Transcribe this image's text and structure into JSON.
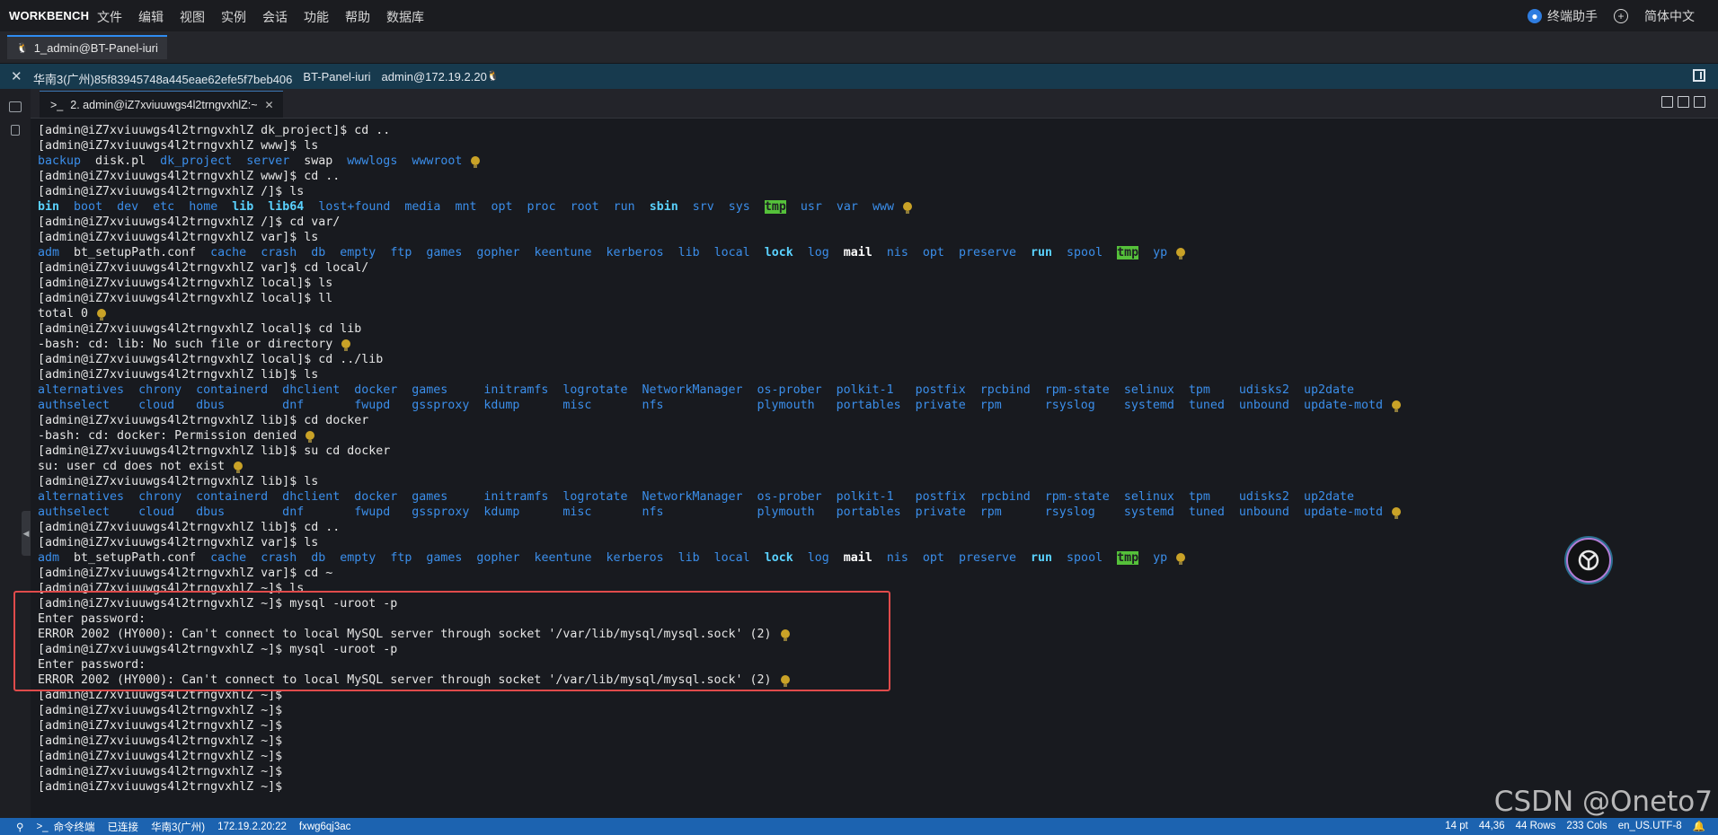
{
  "menubar": {
    "brand": "WORKBENCH",
    "items": [
      "文件",
      "编辑",
      "视图",
      "实例",
      "会话",
      "功能",
      "帮助",
      "数据库"
    ],
    "assistant": "终端助手",
    "language": "简体中文"
  },
  "session_tab": {
    "label": "1_admin@BT-Panel-iuri"
  },
  "infobar": {
    "region": "华南3(广州)85f83945748a445eae62efe5f7beb406",
    "host": "BT-Panel-iuri",
    "user": "admin@172.19.2.20"
  },
  "terminal_tab": {
    "label": "2. admin@iZ7xviuuwgs4l2trngvxhlZ:~",
    "prompt_glyph": ">_"
  },
  "statusbar": {
    "left": [
      "命令终端",
      "已连接",
      "华南3(广州)",
      "172.19.2.20:22",
      "fxwg6qj3ac"
    ],
    "font_size": "14 pt",
    "cursor": "44,36",
    "rows": "44 Rows",
    "cols": "233 Cols",
    "encoding": "en_US.UTF-8"
  },
  "watermark": "CSDN @Oneto7",
  "terminal_lines": [
    [
      [
        "t",
        "[admin@iZ7xviuuwgs4l2trngvxhlZ dk_project]$ cd .."
      ]
    ],
    [
      [
        "t",
        "[admin@iZ7xviuuwgs4l2trngvxhlZ www]$ ls"
      ]
    ],
    [
      [
        "d",
        "backup"
      ],
      [
        "t",
        "  disk.pl  "
      ],
      [
        "d",
        "dk_project"
      ],
      [
        "t",
        "  "
      ],
      [
        "d",
        "server"
      ],
      [
        "t",
        "  swap  "
      ],
      [
        "d",
        "wwwlogs"
      ],
      [
        "t",
        "  "
      ],
      [
        "d",
        "wwwroot"
      ],
      [
        "bulb",
        ""
      ]
    ],
    [
      [
        "t",
        "[admin@iZ7xviuuwgs4l2trngvxhlZ www]$ cd .."
      ]
    ],
    [
      [
        "t",
        "[admin@iZ7xviuuwgs4l2trngvxhlZ /]$ ls"
      ]
    ],
    [
      [
        "bb",
        "bin"
      ],
      [
        "t",
        "  "
      ],
      [
        "d",
        "boot"
      ],
      [
        "t",
        "  "
      ],
      [
        "d",
        "dev"
      ],
      [
        "t",
        "  "
      ],
      [
        "d",
        "etc"
      ],
      [
        "t",
        "  "
      ],
      [
        "d",
        "home"
      ],
      [
        "t",
        "  "
      ],
      [
        "bb",
        "lib"
      ],
      [
        "t",
        "  "
      ],
      [
        "bb",
        "lib64"
      ],
      [
        "t",
        "  "
      ],
      [
        "d",
        "lost+found"
      ],
      [
        "t",
        "  "
      ],
      [
        "d",
        "media"
      ],
      [
        "t",
        "  "
      ],
      [
        "d",
        "mnt"
      ],
      [
        "t",
        "  "
      ],
      [
        "d",
        "opt"
      ],
      [
        "t",
        "  "
      ],
      [
        "d",
        "proc"
      ],
      [
        "t",
        "  "
      ],
      [
        "d",
        "root"
      ],
      [
        "t",
        "  "
      ],
      [
        "d",
        "run"
      ],
      [
        "t",
        "  "
      ],
      [
        "bb",
        "sbin"
      ],
      [
        "t",
        "  "
      ],
      [
        "d",
        "srv"
      ],
      [
        "t",
        "  "
      ],
      [
        "d",
        "sys"
      ],
      [
        "t",
        "  "
      ],
      [
        "tmp",
        "tmp"
      ],
      [
        "t",
        "  "
      ],
      [
        "d",
        "usr"
      ],
      [
        "t",
        "  "
      ],
      [
        "d",
        "var"
      ],
      [
        "t",
        "  "
      ],
      [
        "d",
        "www"
      ],
      [
        "bulb",
        ""
      ]
    ],
    [
      [
        "t",
        "[admin@iZ7xviuuwgs4l2trngvxhlZ /]$ cd var/"
      ]
    ],
    [
      [
        "t",
        "[admin@iZ7xviuuwgs4l2trngvxhlZ var]$ ls"
      ]
    ],
    [
      [
        "d",
        "adm"
      ],
      [
        "t",
        "  bt_setupPath.conf  "
      ],
      [
        "d",
        "cache"
      ],
      [
        "t",
        "  "
      ],
      [
        "d",
        "crash"
      ],
      [
        "t",
        "  "
      ],
      [
        "d",
        "db"
      ],
      [
        "t",
        "  "
      ],
      [
        "d",
        "empty"
      ],
      [
        "t",
        "  "
      ],
      [
        "d",
        "ftp"
      ],
      [
        "t",
        "  "
      ],
      [
        "d",
        "games"
      ],
      [
        "t",
        "  "
      ],
      [
        "d",
        "gopher"
      ],
      [
        "t",
        "  "
      ],
      [
        "d",
        "keentune"
      ],
      [
        "t",
        "  "
      ],
      [
        "d",
        "kerberos"
      ],
      [
        "t",
        "  "
      ],
      [
        "d",
        "lib"
      ],
      [
        "t",
        "  "
      ],
      [
        "d",
        "local"
      ],
      [
        "t",
        "  "
      ],
      [
        "bb",
        "lock"
      ],
      [
        "t",
        "  "
      ],
      [
        "d",
        "log"
      ],
      [
        "t",
        "  "
      ],
      [
        "bold",
        "mail"
      ],
      [
        "t",
        "  "
      ],
      [
        "d",
        "nis"
      ],
      [
        "t",
        "  "
      ],
      [
        "d",
        "opt"
      ],
      [
        "t",
        "  "
      ],
      [
        "d",
        "preserve"
      ],
      [
        "t",
        "  "
      ],
      [
        "bb",
        "run"
      ],
      [
        "t",
        "  "
      ],
      [
        "d",
        "spool"
      ],
      [
        "t",
        "  "
      ],
      [
        "tmp",
        "tmp"
      ],
      [
        "t",
        "  "
      ],
      [
        "d",
        "yp"
      ],
      [
        "bulb",
        ""
      ]
    ],
    [
      [
        "t",
        "[admin@iZ7xviuuwgs4l2trngvxhlZ var]$ cd local/"
      ]
    ],
    [
      [
        "t",
        "[admin@iZ7xviuuwgs4l2trngvxhlZ local]$ ls"
      ]
    ],
    [
      [
        "t",
        "[admin@iZ7xviuuwgs4l2trngvxhlZ local]$ ll"
      ]
    ],
    [
      [
        "t",
        "total 0"
      ],
      [
        "bulb",
        ""
      ]
    ],
    [
      [
        "t",
        "[admin@iZ7xviuuwgs4l2trngvxhlZ local]$ cd lib"
      ]
    ],
    [
      [
        "t",
        "-bash: cd: lib: No such file or directory"
      ],
      [
        "bulb",
        ""
      ]
    ],
    [
      [
        "t",
        "[admin@iZ7xviuuwgs4l2trngvxhlZ local]$ cd ../lib"
      ]
    ],
    [
      [
        "t",
        "[admin@iZ7xviuuwgs4l2trngvxhlZ lib]$ ls"
      ]
    ],
    [
      [
        "d",
        "alternatives  chrony  containerd  dhclient  docker  games     initramfs  logrotate  NetworkManager  os-prober  polkit-1   postfix  rpcbind  rpm-state  selinux  tpm    udisks2  up2date"
      ]
    ],
    [
      [
        "d",
        "authselect    cloud   dbus        dnf       fwupd   gssproxy  kdump      misc       nfs             plymouth   portables  private  rpm      rsyslog    systemd  tuned  unbound  update-motd"
      ],
      [
        "bulb",
        ""
      ]
    ],
    [
      [
        "t",
        "[admin@iZ7xviuuwgs4l2trngvxhlZ lib]$ cd docker"
      ]
    ],
    [
      [
        "t",
        "-bash: cd: docker: Permission denied"
      ],
      [
        "bulb",
        ""
      ]
    ],
    [
      [
        "t",
        "[admin@iZ7xviuuwgs4l2trngvxhlZ lib]$ su cd docker"
      ]
    ],
    [
      [
        "t",
        "su: user cd does not exist"
      ],
      [
        "bulb",
        ""
      ]
    ],
    [
      [
        "t",
        "[admin@iZ7xviuuwgs4l2trngvxhlZ lib]$ ls"
      ]
    ],
    [
      [
        "d",
        "alternatives  chrony  containerd  dhclient  docker  games     initramfs  logrotate  NetworkManager  os-prober  polkit-1   postfix  rpcbind  rpm-state  selinux  tpm    udisks2  up2date"
      ]
    ],
    [
      [
        "d",
        "authselect    cloud   dbus        dnf       fwupd   gssproxy  kdump      misc       nfs             plymouth   portables  private  rpm      rsyslog    systemd  tuned  unbound  update-motd"
      ],
      [
        "bulb",
        ""
      ]
    ],
    [
      [
        "t",
        "[admin@iZ7xviuuwgs4l2trngvxhlZ lib]$ cd .."
      ]
    ],
    [
      [
        "t",
        "[admin@iZ7xviuuwgs4l2trngvxhlZ var]$ ls"
      ]
    ],
    [
      [
        "d",
        "adm"
      ],
      [
        "t",
        "  bt_setupPath.conf  "
      ],
      [
        "d",
        "cache"
      ],
      [
        "t",
        "  "
      ],
      [
        "d",
        "crash"
      ],
      [
        "t",
        "  "
      ],
      [
        "d",
        "db"
      ],
      [
        "t",
        "  "
      ],
      [
        "d",
        "empty"
      ],
      [
        "t",
        "  "
      ],
      [
        "d",
        "ftp"
      ],
      [
        "t",
        "  "
      ],
      [
        "d",
        "games"
      ],
      [
        "t",
        "  "
      ],
      [
        "d",
        "gopher"
      ],
      [
        "t",
        "  "
      ],
      [
        "d",
        "keentune"
      ],
      [
        "t",
        "  "
      ],
      [
        "d",
        "kerberos"
      ],
      [
        "t",
        "  "
      ],
      [
        "d",
        "lib"
      ],
      [
        "t",
        "  "
      ],
      [
        "d",
        "local"
      ],
      [
        "t",
        "  "
      ],
      [
        "bb",
        "lock"
      ],
      [
        "t",
        "  "
      ],
      [
        "d",
        "log"
      ],
      [
        "t",
        "  "
      ],
      [
        "bold",
        "mail"
      ],
      [
        "t",
        "  "
      ],
      [
        "d",
        "nis"
      ],
      [
        "t",
        "  "
      ],
      [
        "d",
        "opt"
      ],
      [
        "t",
        "  "
      ],
      [
        "d",
        "preserve"
      ],
      [
        "t",
        "  "
      ],
      [
        "bb",
        "run"
      ],
      [
        "t",
        "  "
      ],
      [
        "d",
        "spool"
      ],
      [
        "t",
        "  "
      ],
      [
        "tmp",
        "tmp"
      ],
      [
        "t",
        "  "
      ],
      [
        "d",
        "yp"
      ],
      [
        "bulb",
        ""
      ]
    ],
    [
      [
        "t",
        "[admin@iZ7xviuuwgs4l2trngvxhlZ var]$ cd ~"
      ]
    ],
    [
      [
        "t",
        "[admin@iZ7xviuuwgs4l2trngvxhlZ ~]$ ls"
      ]
    ],
    [
      [
        "t",
        "[admin@iZ7xviuuwgs4l2trngvxhlZ ~]$ mysql -uroot -p"
      ]
    ],
    [
      [
        "t",
        "Enter password:"
      ]
    ],
    [
      [
        "t",
        "ERROR 2002 (HY000): Can't connect to local MySQL server through socket '/var/lib/mysql/mysql.sock' (2)"
      ],
      [
        "bulb",
        ""
      ]
    ],
    [
      [
        "t",
        "[admin@iZ7xviuuwgs4l2trngvxhlZ ~]$ mysql -uroot -p"
      ]
    ],
    [
      [
        "t",
        "Enter password:"
      ]
    ],
    [
      [
        "t",
        "ERROR 2002 (HY000): Can't connect to local MySQL server through socket '/var/lib/mysql/mysql.sock' (2)"
      ],
      [
        "bulb",
        ""
      ]
    ],
    [
      [
        "t",
        "[admin@iZ7xviuuwgs4l2trngvxhlZ ~]$"
      ]
    ],
    [
      [
        "t",
        "[admin@iZ7xviuuwgs4l2trngvxhlZ ~]$"
      ]
    ],
    [
      [
        "t",
        "[admin@iZ7xviuuwgs4l2trngvxhlZ ~]$"
      ]
    ],
    [
      [
        "t",
        "[admin@iZ7xviuuwgs4l2trngvxhlZ ~]$"
      ]
    ],
    [
      [
        "t",
        "[admin@iZ7xviuuwgs4l2trngvxhlZ ~]$"
      ]
    ],
    [
      [
        "t",
        "[admin@iZ7xviuuwgs4l2trngvxhlZ ~]$"
      ]
    ],
    [
      [
        "t",
        "[admin@iZ7xviuuwgs4l2trngvxhlZ ~]$"
      ]
    ]
  ],
  "colors": {
    "directory": "#3b8eea",
    "bold_dir": "#5ad2ff",
    "tmp_bg": "#55c13a",
    "highlight_box": "#e04b4b",
    "status_bar": "#1c63b0",
    "info_bar": "#173a4e"
  }
}
